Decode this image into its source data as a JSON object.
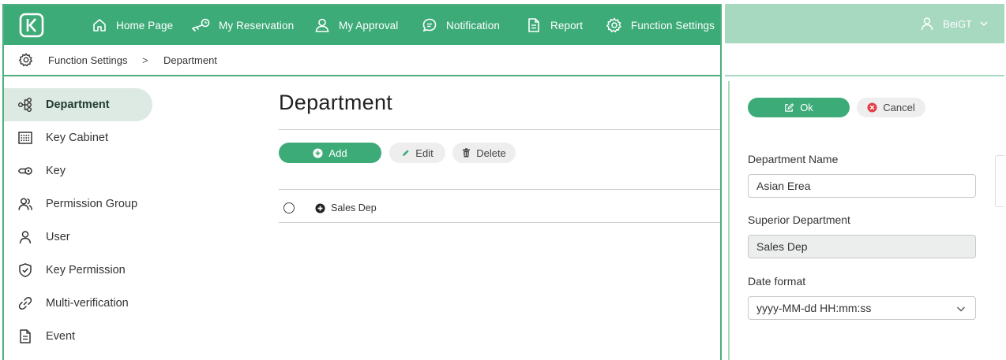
{
  "nav": {
    "items": [
      {
        "label": "Home Page",
        "icon": "home-icon"
      },
      {
        "label": "My Reservation",
        "icon": "key-reservation-icon"
      },
      {
        "label": "My Approval",
        "icon": "user-icon"
      },
      {
        "label": "Notification",
        "icon": "chat-icon"
      },
      {
        "label": "Report",
        "icon": "document-icon"
      },
      {
        "label": "Function Settings",
        "icon": "gear-icon"
      }
    ]
  },
  "breadcrumb": {
    "section": "Function Settings",
    "separator": ">",
    "page": "Department"
  },
  "sidebar": {
    "items": [
      {
        "label": "Department",
        "icon": "org-chart-icon",
        "active": true
      },
      {
        "label": "Key Cabinet",
        "icon": "cabinet-icon"
      },
      {
        "label": "Key",
        "icon": "key-icon"
      },
      {
        "label": "Permission Group",
        "icon": "users-icon"
      },
      {
        "label": "User",
        "icon": "user-icon"
      },
      {
        "label": "Key Permission",
        "icon": "shield-check-icon"
      },
      {
        "label": "Multi-verification",
        "icon": "link-icon"
      },
      {
        "label": "Event",
        "icon": "document-icon"
      }
    ]
  },
  "main": {
    "title": "Department",
    "toolbar": {
      "add_label": "Add",
      "edit_label": "Edit",
      "delete_label": "Delete"
    },
    "tree": [
      {
        "label": "Sales Dep",
        "expandable": true,
        "selected": false
      }
    ]
  },
  "user": {
    "name": "BeiGT"
  },
  "form": {
    "ok_label": "Ok",
    "cancel_label": "Cancel",
    "department_name_label": "Department Name",
    "department_name_value": "Asian Erea",
    "superior_department_label": "Superior Department",
    "superior_department_value": "Sales Dep",
    "date_format_label": "Date format",
    "date_format_value": "yyyy-MM-dd HH:mm:ss"
  },
  "colors": {
    "primary": "#3dab78",
    "primary_light": "#a7d8c0",
    "active_bg": "#dde9e3",
    "cancel_red": "#e0414a"
  }
}
